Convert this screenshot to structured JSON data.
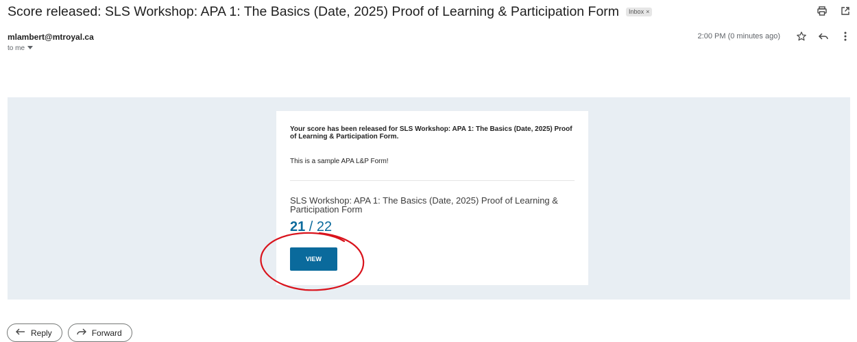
{
  "email": {
    "subject": "Score released: SLS Workshop: APA 1: The Basics (Date, 2025) Proof of Learning & Participation Form",
    "label": "Inbox",
    "label_remove": "×",
    "sender": "mlambert@mtroyal.ca",
    "recipient": "to me",
    "timestamp": "2:00 PM (0 minutes ago)"
  },
  "icons": {
    "print": "print-icon",
    "open_new_window": "open-in-new-window-icon",
    "star": "star-icon",
    "reply": "reply-icon",
    "more": "more-vert-icon",
    "dropdown": "caret-down-icon",
    "forward": "forward-icon"
  },
  "card": {
    "message": "Your score has been released for SLS Workshop: APA 1: The Basics (Date, 2025) Proof of Learning & Participation Form.",
    "sample_text": "This is a sample APA L&P Form!",
    "form_title": "SLS Workshop: APA 1: The Basics (Date, 2025) Proof of Learning & Participation Form",
    "score_got": "21",
    "score_sep": " / ",
    "score_total": "22",
    "view_label": "VIEW"
  },
  "actions": {
    "reply_label": "Reply",
    "forward_label": "Forward"
  },
  "colors": {
    "banner": "#e8eef3",
    "accent": "#0a6a9c",
    "annotation": "#d9131c"
  }
}
